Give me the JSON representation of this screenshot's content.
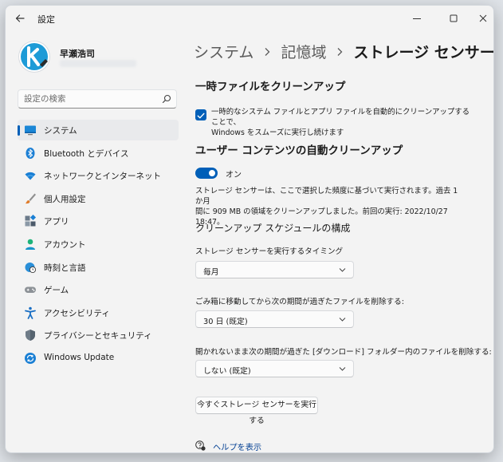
{
  "window": {
    "title": "設定"
  },
  "profile": {
    "name": "早瀬浩司"
  },
  "search": {
    "placeholder": "設定の検索"
  },
  "nav": {
    "items": [
      {
        "label": "システム",
        "icon": "monitor-icon",
        "active": true
      },
      {
        "label": "Bluetooth とデバイス",
        "icon": "bluetooth-icon"
      },
      {
        "label": "ネットワークとインターネット",
        "icon": "wifi-icon"
      },
      {
        "label": "個人用設定",
        "icon": "brush-icon"
      },
      {
        "label": "アプリ",
        "icon": "apps-icon"
      },
      {
        "label": "アカウント",
        "icon": "person-icon"
      },
      {
        "label": "時刻と言語",
        "icon": "globe-clock-icon"
      },
      {
        "label": "ゲーム",
        "icon": "gamepad-icon"
      },
      {
        "label": "アクセシビリティ",
        "icon": "accessibility-icon"
      },
      {
        "label": "プライバシーとセキュリティ",
        "icon": "shield-icon"
      },
      {
        "label": "Windows Update",
        "icon": "update-icon"
      }
    ]
  },
  "breadcrumb": {
    "items": [
      "システム",
      "記憶域",
      "ストレージ センサー"
    ]
  },
  "temp": {
    "heading": "一時ファイルをクリーンアップ",
    "checkbox_line1": "一時的なシステム ファイルとアプリ ファイルを自動的にクリーンアップすることで、",
    "checkbox_line2": "Windows をスムーズに実行し続けます",
    "checked": true
  },
  "auto": {
    "heading": "ユーザー コンテンツの自動クリーンアップ",
    "toggle_label": "オン",
    "toggle_on": true,
    "desc_line1": "ストレージ センサーは、ここで選択した頻度に基づいて実行されます。過去 1 か月",
    "desc_line2": "間に 909 MB の領域をクリーンアップしました。前回の実行: 2022/10/27 18:47。"
  },
  "schedule": {
    "heading": "クリーンアップ スケジュールの構成",
    "timing_label": "ストレージ センサーを実行するタイミング",
    "timing_value": "毎月",
    "recycle_label": "ごみ箱に移動してから次の期間が過ぎたファイルを削除する:",
    "recycle_value": "30 日 (既定)",
    "downloads_label": "開かれないまま次の期間が過ぎた [ダウンロード] フォルダー内のファイルを削除する:",
    "downloads_value": "しない (既定)"
  },
  "actions": {
    "run_now": "今すぐストレージ センサーを実行する"
  },
  "help": {
    "label": "ヘルプを表示"
  },
  "colors": {
    "accent": "#005fb8",
    "window_bg": "#f3f3f3",
    "link": "#003e92"
  }
}
